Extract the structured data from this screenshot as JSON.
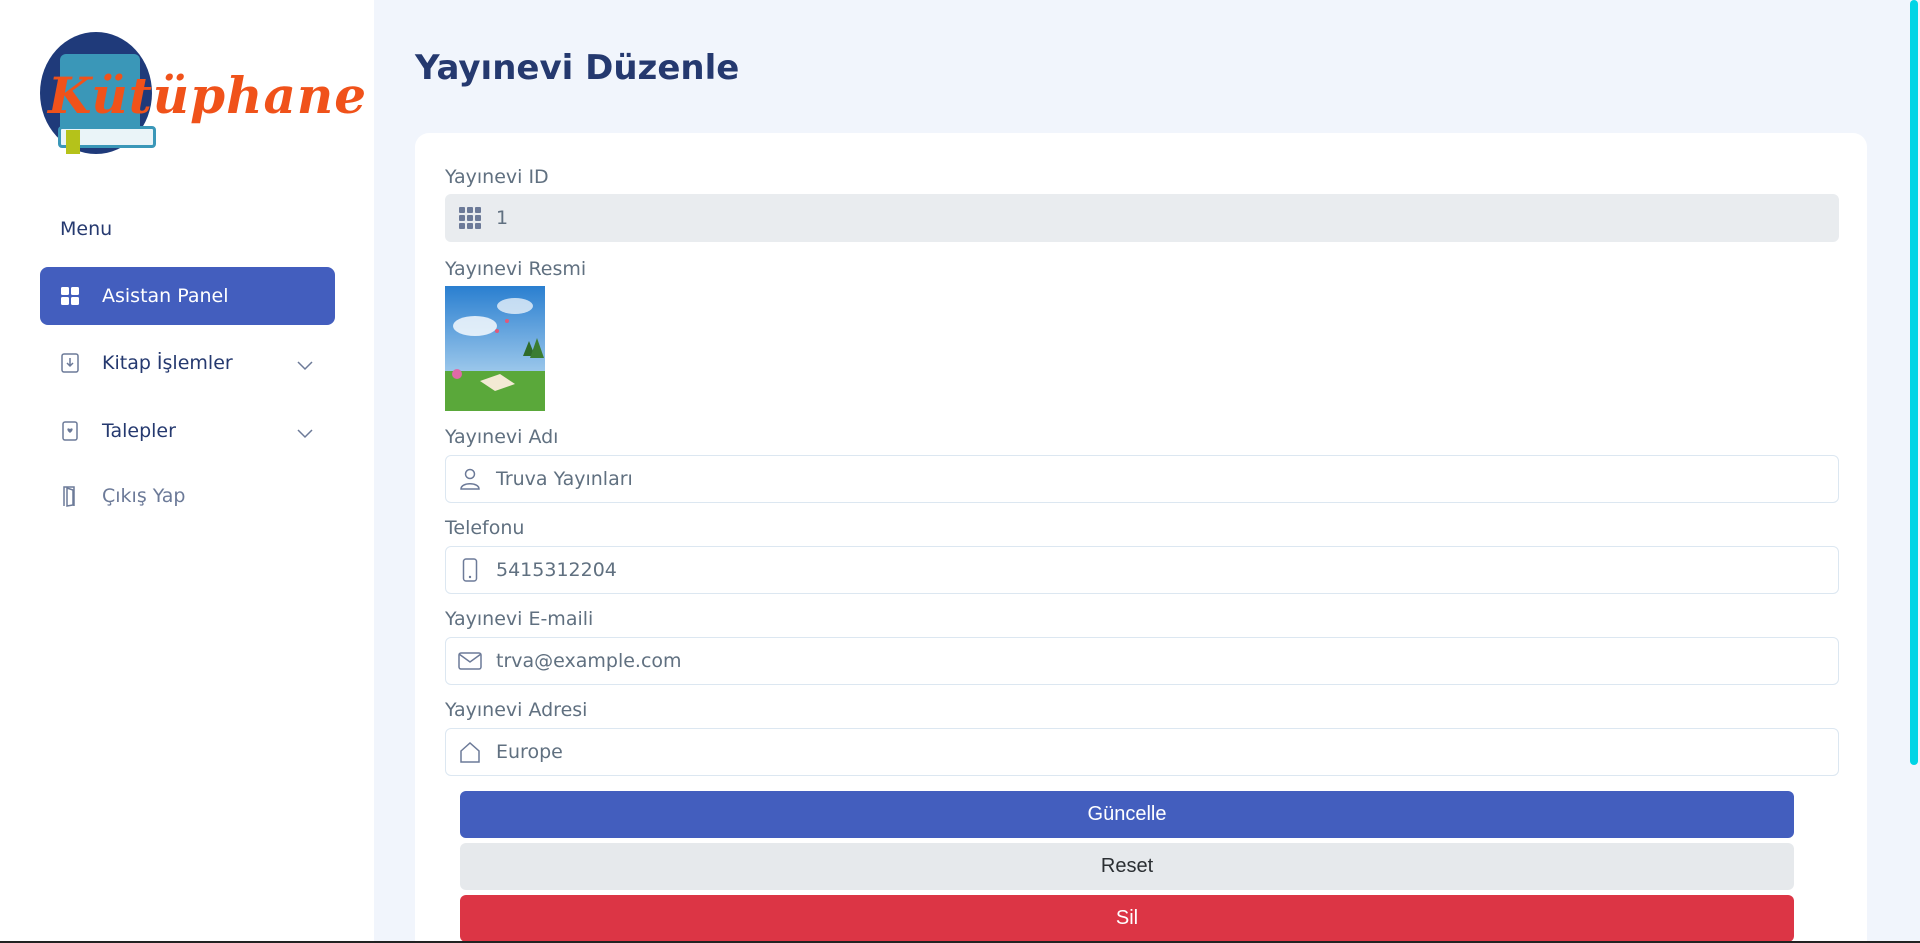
{
  "brand": {
    "logo_text": "Kütüphane"
  },
  "sidebar": {
    "menu_title": "Menu",
    "items": [
      {
        "label": "Asistan Panel",
        "icon": "grid-icon"
      },
      {
        "label": "Kitap İşlemler",
        "icon": "download-box-icon"
      },
      {
        "label": "Talepler",
        "icon": "bookmark-heart-icon"
      },
      {
        "label": "Çıkış Yap",
        "icon": "door-icon"
      }
    ]
  },
  "page": {
    "title": "Yayınevi Düzenle"
  },
  "form": {
    "id": {
      "label": "Yayınevi ID",
      "value": "1",
      "icon": "grid-3x3-icon"
    },
    "image": {
      "label": "Yayınevi Resmi"
    },
    "name": {
      "label": "Yayınevi Adı",
      "value": "Truva Yayınları",
      "icon": "person-icon"
    },
    "phone": {
      "label": "Telefonu",
      "value": "5415312204",
      "icon": "phone-icon"
    },
    "email": {
      "label": "Yayınevi E-maili",
      "value": "trva@example.com",
      "icon": "envelope-icon"
    },
    "address": {
      "label": "Yayınevi Adresi",
      "value": "Europe",
      "icon": "house-icon"
    }
  },
  "buttons": {
    "update": "Güncelle",
    "reset": "Reset",
    "delete": "Sil"
  },
  "colors": {
    "primary": "#435ebe",
    "danger": "#dc3545",
    "secondary": "#e6e9ec",
    "background": "#f1f5fc"
  }
}
